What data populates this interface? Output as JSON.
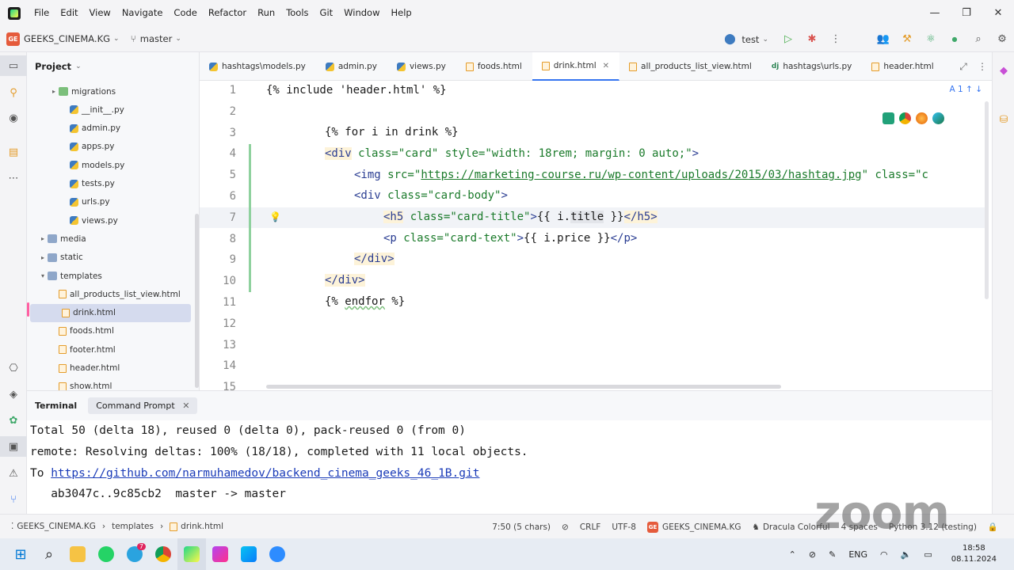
{
  "menu": {
    "items": [
      "File",
      "Edit",
      "View",
      "Navigate",
      "Code",
      "Refactor",
      "Run",
      "Tools",
      "Git",
      "Window",
      "Help"
    ]
  },
  "toolbar": {
    "project_badge": "GE",
    "project_name": "GEEKS_CINEMA.KG",
    "branch": "master",
    "run_config": "test"
  },
  "project_panel": {
    "title": "Project",
    "items": [
      {
        "label": "migrations",
        "type": "folder",
        "indent": 2,
        "arrow": "▸"
      },
      {
        "label": "__init__.py",
        "type": "py",
        "indent": 3
      },
      {
        "label": "admin.py",
        "type": "py",
        "indent": 3
      },
      {
        "label": "apps.py",
        "type": "py",
        "indent": 3
      },
      {
        "label": "models.py",
        "type": "py",
        "indent": 3
      },
      {
        "label": "tests.py",
        "type": "py",
        "indent": 3
      },
      {
        "label": "urls.py",
        "type": "py",
        "indent": 3
      },
      {
        "label": "views.py",
        "type": "py",
        "indent": 3
      },
      {
        "label": "media",
        "type": "folder",
        "indent": 1,
        "arrow": "▸"
      },
      {
        "label": "static",
        "type": "folder",
        "indent": 1,
        "arrow": "▸"
      },
      {
        "label": "templates",
        "type": "folder",
        "indent": 1,
        "arrow": "▾"
      },
      {
        "label": "all_products_list_view.html",
        "type": "html",
        "indent": 2
      },
      {
        "label": "drink.html",
        "type": "html",
        "indent": 2,
        "selected": true
      },
      {
        "label": "foods.html",
        "type": "html",
        "indent": 2
      },
      {
        "label": "footer.html",
        "type": "html",
        "indent": 2
      },
      {
        "label": "header.html",
        "type": "html",
        "indent": 2
      },
      {
        "label": "show.html",
        "type": "html",
        "indent": 2
      }
    ]
  },
  "tabs": [
    {
      "label": "hashtags\\models.py",
      "icon": "py"
    },
    {
      "label": "admin.py",
      "icon": "py"
    },
    {
      "label": "views.py",
      "icon": "py"
    },
    {
      "label": "foods.html",
      "icon": "html"
    },
    {
      "label": "drink.html",
      "icon": "html",
      "active": true
    },
    {
      "label": "all_products_list_view.html",
      "icon": "html"
    },
    {
      "label": "hashtags\\urls.py",
      "icon": "dj"
    },
    {
      "label": "header.html",
      "icon": "html"
    }
  ],
  "editor": {
    "hint": "A 1",
    "line_numbers": [
      "1",
      "2",
      "3",
      "4",
      "5",
      "6",
      "7",
      "8",
      "9",
      "10",
      "11",
      "12",
      "13",
      "14",
      "15"
    ],
    "lines": {
      "l1": "{% include 'header.html' %}",
      "l3": "{% for i in drink %}",
      "l4_open": "<div",
      "l4_attr": " class=",
      "l4_v1": "\"card\"",
      "l4_attr2": " style=",
      "l4_v2": "\"width: 18rem; margin: 0 auto;\"",
      "l4_close": ">",
      "l5_open": "<img",
      "l5_attr": " src=",
      "l5_q": "\"",
      "l5_url": "https://marketing-course.ru/wp-content/uploads/2015/03/hashtag.jpg",
      "l5_attr2": " class=",
      "l5_v2": "\"c",
      "l6_open": "<div",
      "l6_attr": " class=",
      "l6_v": "\"card-body\"",
      "l6_close": ">",
      "l7_open": "<h5",
      "l7_attr": " class=",
      "l7_v": "\"card-title\"",
      "l7_close": ">",
      "l7_tpl1": "{{ i.",
      "l7_word": "title",
      "l7_tpl2": " }}",
      "l7_end": "</h5>",
      "l8_open": "<p",
      "l8_attr": " class=",
      "l8_v": "\"card-text\"",
      "l8_close": ">",
      "l8_tpl": "{{ i.price }}",
      "l8_end": "</p>",
      "l9": "</div>",
      "l10": "</div>",
      "l11_a": "{% ",
      "l11_kw": "endfor",
      "l11_b": " %}"
    }
  },
  "terminal": {
    "tab_title": "Terminal",
    "tab_active": "Command Prompt",
    "lines": {
      "t1": "Total 50 (delta 18), reused 0 (delta 0), pack-reused 0 (from 0)",
      "t2": "remote: Resolving deltas: 100% (18/18), completed with 11 local objects.",
      "t3_prefix": "To ",
      "t3_link": "https://github.com/narmuhamedov/backend_cinema_geeks_46_1B.git",
      "t4": "   ab3047c..9c85cb2  master -> master"
    }
  },
  "statusbar": {
    "path1": "GEEKS_CINEMA.KG",
    "path2": "templates",
    "path3": "drink.html",
    "position": "7:50 (5 chars)",
    "line_sep": "CRLF",
    "encoding": "UTF-8",
    "project_badge": "GE",
    "project": "GEEKS_CINEMA.KG",
    "theme": "Dracula Colorful",
    "indent": "4 spaces",
    "interpreter": "Python 3.12 (testing)"
  },
  "watermark": "zoom",
  "taskbar": {
    "telegram_badge": "7",
    "lang": "ENG",
    "time": "18:58",
    "date": "08.11.2024"
  },
  "colors": {
    "accent": "#3574f0",
    "change_bar": "#8fd19e",
    "tag": "#2a3d92",
    "string": "#1a7a2a"
  }
}
